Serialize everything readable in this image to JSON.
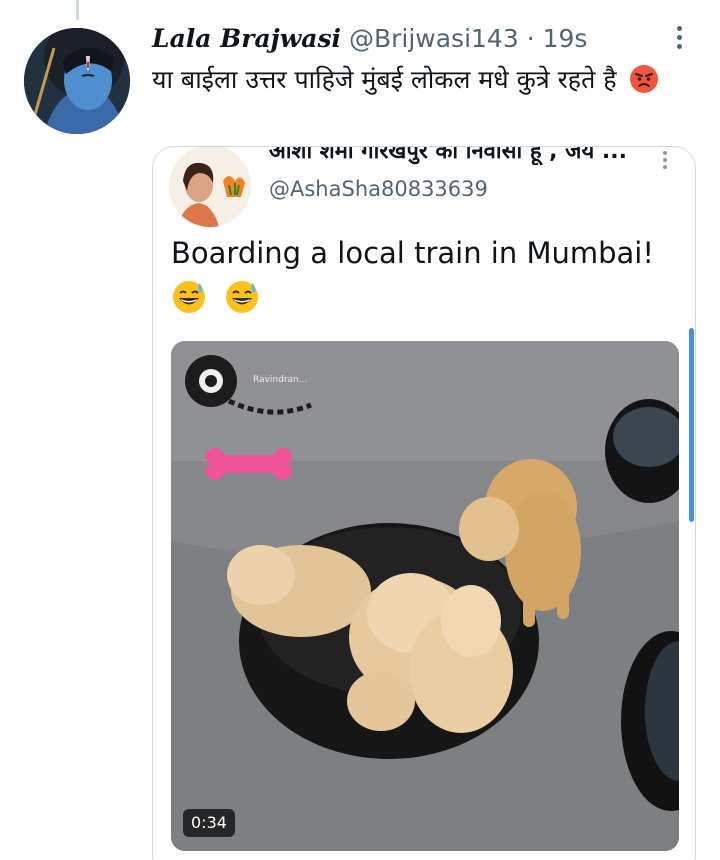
{
  "tweet": {
    "display_name": "Lala Brajwasi",
    "handle": "@Brijwasi143",
    "separator": "·",
    "time": "19s",
    "text": "या बाईला उत्तर पाहिजे मुंबई लोकल मधे कुत्रे रहते है"
  },
  "quoted_tweet": {
    "display_name": "आशा शर्मा गोरखपुर का निवासी हूं , जय ...",
    "handle": "@AshaSha80833639",
    "text": "Boarding a local train in Mumbai!",
    "video": {
      "duration": "0:34",
      "watermark": "Ravindran..."
    }
  },
  "icons": {
    "more": "more-vertical-icon",
    "emoji_tweet": "angry-face-emoji-icon",
    "emoji_quote": "grinning-sweat-emoji-icon"
  },
  "colors": {
    "secondary_text": "#536471",
    "border": "#cfd9de",
    "scroll_accent": "#4a90e2"
  }
}
